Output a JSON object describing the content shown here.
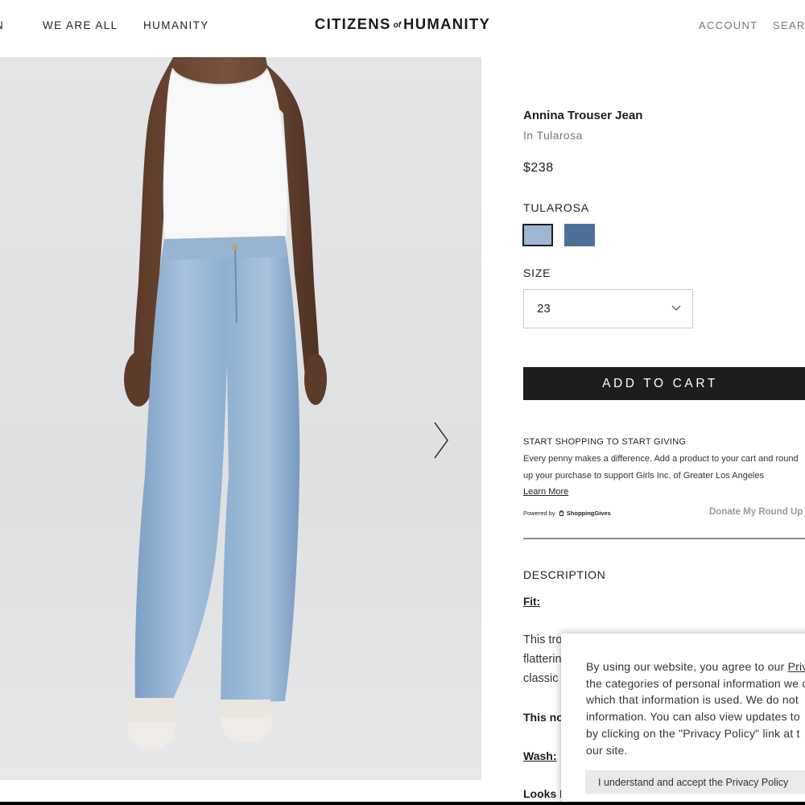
{
  "header": {
    "nav_left": [
      "N",
      "WE ARE ALL",
      "HUMANITY"
    ],
    "logo": {
      "part1": "CITIZENS",
      "of": "of",
      "part2": "HUMANITY"
    },
    "nav_right": [
      "ACCOUNT",
      "SEARC"
    ]
  },
  "product": {
    "title": "Annina Trouser Jean",
    "subtitle": "In Tularosa",
    "price": "$238",
    "color_label": "TULAROSA",
    "swatches": [
      {
        "color": "#9db6d4",
        "selected": true
      },
      {
        "color": "#4f6f97",
        "selected": false
      }
    ],
    "size_label": "SIZE",
    "size_value": "23",
    "add_to_cart": "ADD TO CART"
  },
  "giving": {
    "title": "START SHOPPING TO START GIVING",
    "line1": "Every penny makes a difference. Add a product to your cart and round",
    "line2": "up your purchase to support Girls Inc. of Greater Los Angeles",
    "learn_more": "Learn More",
    "powered_by": "Powered by",
    "powered_brand": "ShoppingGives",
    "donate": "Donate My Round Up"
  },
  "description": {
    "label": "DESCRIPTION",
    "fit_label": "Fit:",
    "lines": [
      "This tro",
      "flatterin",
      "classic"
    ],
    "bold1": "This no",
    "wash_label": "Wash:",
    "bold2": "Looks L"
  },
  "cookie": {
    "line1_prefix": "By using our website, you agree to our ",
    "line1_link": "Priv",
    "line2": "the categories of personal information we c",
    "line3": "which that information is used. We do not",
    "line4": "information. You can also view updates to",
    "line5": "by clicking on the \"Privacy Policy\" link at t",
    "line6": "our site.",
    "accept_button": "I understand and accept the Privacy Policy"
  },
  "colors": {
    "button_dark": "#1d1d1d",
    "text_muted": "#777777",
    "denim_light": "#8fb0d2",
    "background_gray": "#e2e3e5"
  }
}
